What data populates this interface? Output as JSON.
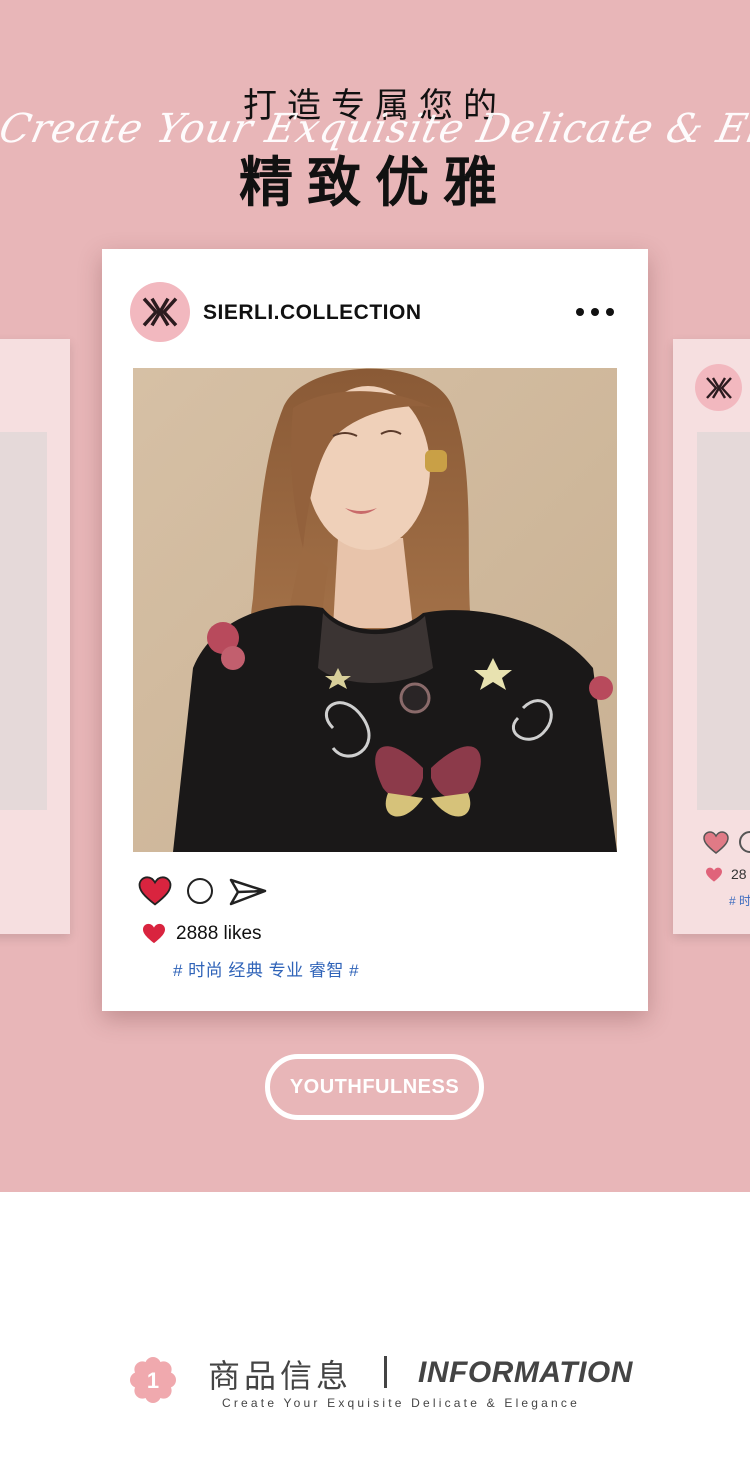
{
  "colors": {
    "background_pink": "#e8b6b8",
    "card_white": "#ffffff",
    "heart_red": "#d9243f",
    "tag_blue": "#2f63b8",
    "avatar_pink": "#f2b8bf",
    "text_dark": "#111111"
  },
  "hero": {
    "title_line1": "打造专属您的",
    "script_text": "Create Your Exquisite Delicate & Elegance",
    "title_line2": "精致优雅"
  },
  "post": {
    "account_name": "SIERLI.COLLECTION",
    "avatar_icon": "sierli-logo-icon",
    "more_icon": "more-dots-icon",
    "photo_description_icon": "product-photo",
    "actions": [
      "heart-icon",
      "comment-icon",
      "share-icon"
    ],
    "likes": "2888 likes",
    "tags": "# 时尚 经典 专业 睿智 #"
  },
  "side_card": {
    "likes_partial": "28",
    "tag_partial": "# 时"
  },
  "pill": {
    "label": "YOUTHFULNESS"
  },
  "info": {
    "badge_number": "1",
    "title_cn": "商品信息",
    "title_en": "INFORMATION",
    "subtitle": "Create Your Exquisite Delicate & Elegance"
  }
}
